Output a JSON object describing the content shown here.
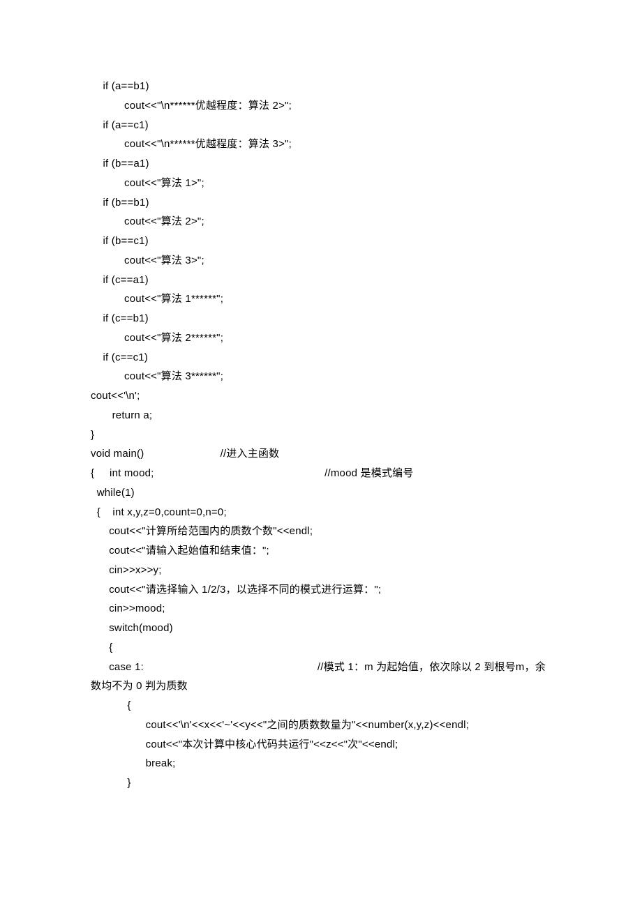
{
  "lines": [
    "    if (a==b1)",
    "           cout<<\"\\n******优越程度：算法 2>\";",
    "    if (a==c1)",
    "           cout<<\"\\n******优越程度：算法 3>\";",
    "",
    "    if (b==a1)",
    "           cout<<\"算法 1>\";",
    "    if (b==b1)",
    "           cout<<\"算法 2>\";",
    "    if (b==c1)",
    "           cout<<\"算法 3>\";",
    "",
    "    if (c==a1)",
    "           cout<<\"算法 1******\";",
    "    if (c==b1)",
    "           cout<<\"算法 2******\";",
    "    if (c==c1)",
    "           cout<<\"算法 3******\";",
    "cout<<'\\n';",
    "",
    "       return a;",
    "}",
    "",
    "",
    "",
    "void main()                         //进入主函数",
    "{     int mood;                                                        //mood 是模式编号",
    "  while(1)",
    "  {    int x,y,z=0,count=0,n=0;",
    "      cout<<\"计算所给范围内的质数个数\"<<endl;",
    "      cout<<\"请输入起始值和结束值：\";",
    "      cin>>x>>y;",
    "      cout<<\"请选择输入 1/2/3，以选择不同的模式进行运算：\";",
    "      cin>>mood;",
    "      switch(mood)",
    "      {",
    "      case 1:                                                         //模式 1：m 为起始值，依次除以 2 到根号m，余数均不为 0 判为质数",
    "            {",
    "                  cout<<'\\n'<<x<<'~'<<y<<\"之间的质数数量为\"<<number(x,y,z)<<endl;",
    "                  cout<<\"本次计算中核心代码共运行\"<<z<<\"次\"<<endl;",
    "                  break;",
    "            }"
  ]
}
